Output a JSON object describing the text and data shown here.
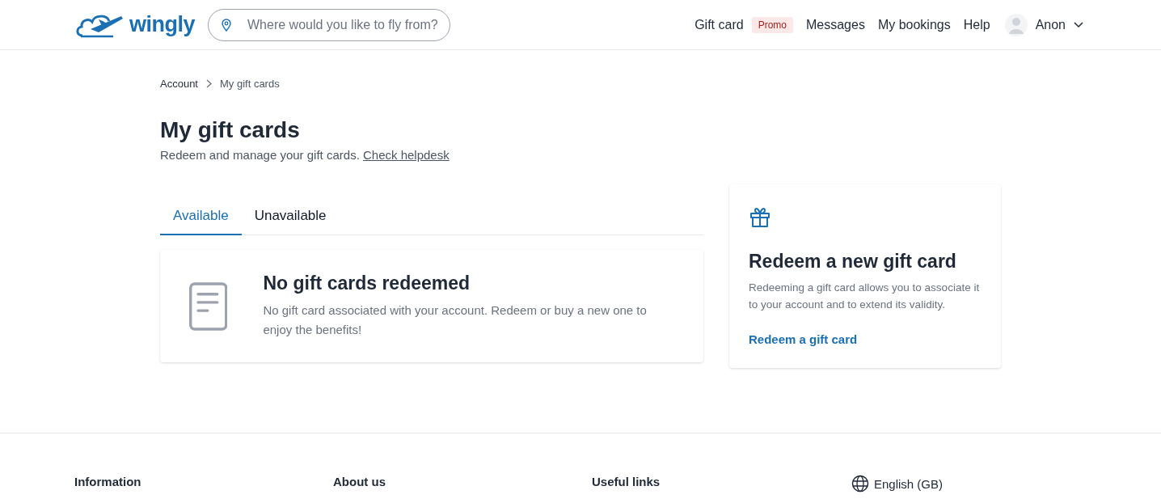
{
  "header": {
    "logo": "wingly",
    "search": {
      "placeholder": "Where would you like to fly from?"
    },
    "nav": [
      {
        "label": "Gift card",
        "badge": "Promo"
      },
      {
        "label": "Messages"
      },
      {
        "label": "My bookings"
      },
      {
        "label": "Help"
      }
    ],
    "user": {
      "name": "Anon"
    }
  },
  "breadcrumb": [
    "Account",
    "My gift cards"
  ],
  "page": {
    "title": "My gift cards",
    "subtitle": "Redeem and manage your gift cards.",
    "link": "Check helpdesk"
  },
  "tabs": [
    {
      "label": "Available",
      "selected": true
    },
    {
      "label": "Unavailable",
      "selected": false
    }
  ],
  "empty_state": {
    "title": "No gift cards redeemed",
    "text": "No gift card associated with your account. Redeem or buy a new one to enjoy the benefits!"
  },
  "redeem_card": {
    "title": "Redeem a new gift card",
    "text": "Redeeming a gift card allows you to associate it to your account and to extend its validity.",
    "link": "Redeem a gift card"
  },
  "footer": {
    "columns": [
      "Information",
      "About us",
      "Useful links"
    ],
    "language": "English (GB)"
  }
}
